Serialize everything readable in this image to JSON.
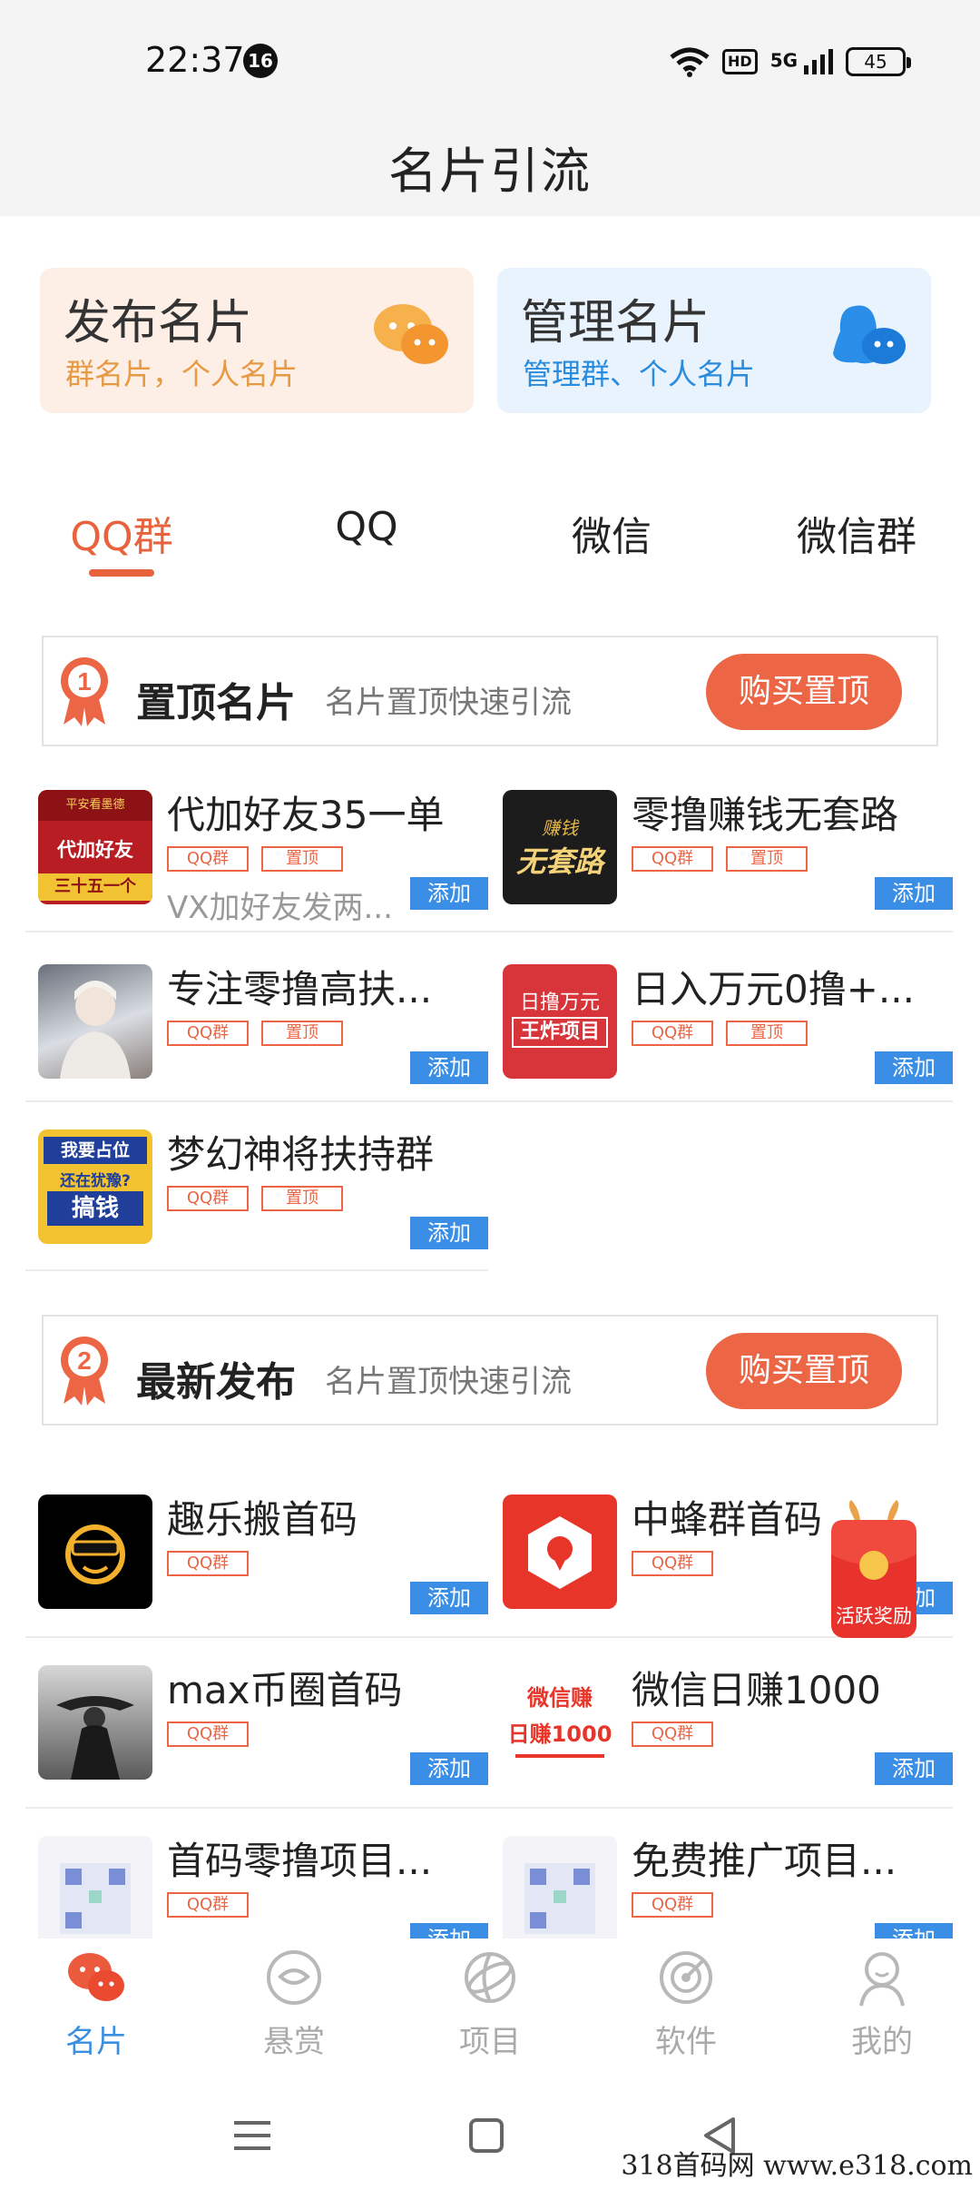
{
  "status_bar": {
    "time": "22:37",
    "notification_count": "16",
    "hd_label": "HD",
    "network_label": "5G",
    "battery": "45"
  },
  "header": {
    "title": "名片引流"
  },
  "cards": {
    "publish": {
      "title": "发布名片",
      "subtitle": "群名片，个人名片"
    },
    "manage": {
      "title": "管理名片",
      "subtitle": "管理群、个人名片"
    }
  },
  "tabs": [
    "QQ群",
    "QQ",
    "微信",
    "微信群"
  ],
  "sections": {
    "pinned": {
      "title": "置顶名片",
      "subtitle": "名片置顶快速引流",
      "button": "购买置顶",
      "medal": "1",
      "items": [
        {
          "name": "代加好友35一单",
          "tags": [
            "QQ群",
            "置顶"
          ],
          "desc": "VX加好友发两...",
          "add": "添加"
        },
        {
          "name": "零撸赚钱无套路",
          "tags": [
            "QQ群",
            "置顶"
          ],
          "desc": "",
          "add": "添加"
        },
        {
          "name": "专注零撸高扶...",
          "tags": [
            "QQ群",
            "置顶"
          ],
          "desc": "",
          "add": "添加"
        },
        {
          "name": "日入万元0撸+...",
          "tags": [
            "QQ群",
            "置顶"
          ],
          "desc": "",
          "add": "添加"
        },
        {
          "name": "梦幻神将扶持群",
          "tags": [
            "QQ群",
            "置顶"
          ],
          "desc": "",
          "add": "添加"
        }
      ],
      "thumb_texts": {
        "t1_top": "平安看墨德",
        "t1_mid": "代加好友",
        "t1_bot": "三十五一个",
        "t2_top": "赚钱",
        "t2_main": "无套路",
        "t4_top": "日撸万元",
        "t4_main": "王炸项目",
        "t5_top": "我要占位",
        "t5_mid": "还在犹豫?",
        "t5_main": "搞钱"
      }
    },
    "latest": {
      "title": "最新发布",
      "subtitle": "名片置顶快速引流",
      "button": "购买置顶",
      "medal": "2",
      "items": [
        {
          "name": "趣乐搬首码",
          "tags": [
            "QQ群"
          ],
          "add": "添加"
        },
        {
          "name": "中蜂群首码",
          "tags": [
            "QQ群"
          ],
          "add": "添加"
        },
        {
          "name": "max币圈首码",
          "tags": [
            "QQ群"
          ],
          "add": "添加"
        },
        {
          "name": "微信日赚1000",
          "tags": [
            "QQ群"
          ],
          "add": "添加"
        },
        {
          "name": "首码零撸项目...",
          "tags": [
            "QQ群"
          ],
          "add": "添加"
        },
        {
          "name": "免费推广项目...",
          "tags": [
            "QQ群"
          ],
          "add": "添加"
        }
      ],
      "thumb_texts": {
        "t4_top": "微信赚",
        "t4_main": "日赚1000"
      }
    }
  },
  "floating": {
    "label": "活跃奖励"
  },
  "bottom_nav": [
    {
      "label": "名片",
      "icon": "wechat-chat-icon"
    },
    {
      "label": "悬赏",
      "icon": "reward-icon"
    },
    {
      "label": "项目",
      "icon": "globe-icon"
    },
    {
      "label": "软件",
      "icon": "software-icon"
    },
    {
      "label": "我的",
      "icon": "profile-icon"
    }
  ],
  "watermark": "318首码网 www.e318.com",
  "colors": {
    "accent_orange": "#ec6545",
    "tab_active": "#e8633d",
    "add_blue": "#3a8ee6",
    "nav_active": "#3b8fdf"
  }
}
